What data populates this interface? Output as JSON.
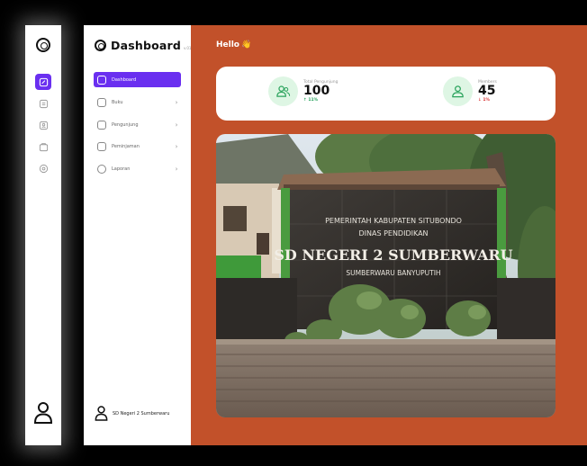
{
  "app": {
    "title": "Dashboard",
    "version": "v.01"
  },
  "sidebar": {
    "items": [
      {
        "label": "Dashboard",
        "active": true,
        "has_chevron": false
      },
      {
        "label": "Buku",
        "active": false,
        "has_chevron": true
      },
      {
        "label": "Pengunjung",
        "active": false,
        "has_chevron": true
      },
      {
        "label": "Peminjaman",
        "active": false,
        "has_chevron": true
      },
      {
        "label": "Laporan",
        "active": false,
        "has_chevron": true
      }
    ],
    "user": "SD Negeri 2 Sumberwaru"
  },
  "main": {
    "greeting": "Hello",
    "greeting_emoji": "👋",
    "stats": [
      {
        "label": "Total Pengunjung",
        "value": "100",
        "trend": "11%",
        "direction": "up"
      },
      {
        "label": "Members",
        "value": "45",
        "trend": "1%",
        "direction": "down"
      }
    ],
    "photo": {
      "sign_line1": "PEMERINTAH KABUPATEN SITUBONDO",
      "sign_line2": "DINAS PENDIDIKAN",
      "sign_line3": "SD NEGERI 2 SUMBERWARU",
      "sign_line4": "SUMBERWARU  BANYUPUTIH"
    }
  },
  "colors": {
    "accent": "#6a2ff0",
    "main_bg": "#c2512a",
    "stat_icon_bg": "#def6e4",
    "trend_up": "#23a15a",
    "trend_down": "#d93232"
  },
  "icons": {
    "rail": [
      "logo-icon",
      "dashboard-icon",
      "book-icon",
      "visitor-icon",
      "borrow-icon",
      "report-icon",
      "user-icon"
    ]
  }
}
